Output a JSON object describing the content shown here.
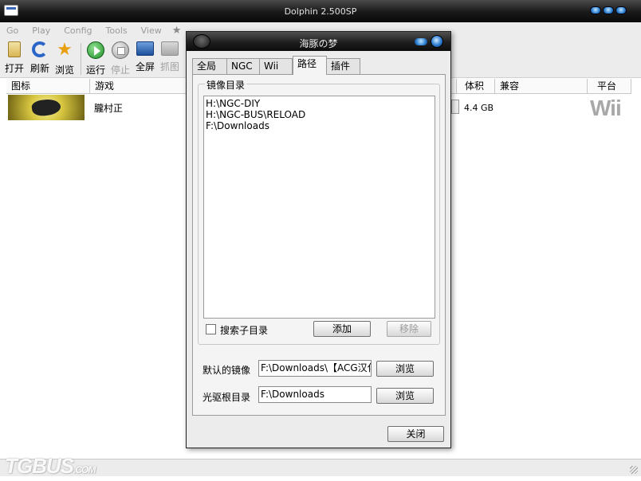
{
  "main_window": {
    "title": "Dolphin 2.500SP",
    "menu": [
      "Go",
      "Play",
      "Config",
      "Tools",
      "View"
    ],
    "toolbar": [
      {
        "label": "打开",
        "icon": "open-file-icon",
        "enabled": true
      },
      {
        "label": "刷新",
        "icon": "refresh-icon",
        "enabled": true
      },
      {
        "label": "浏览",
        "icon": "browse-star-icon",
        "enabled": true
      },
      {
        "label": "运行",
        "icon": "play-icon",
        "enabled": true
      },
      {
        "label": "停止",
        "icon": "stop-icon",
        "enabled": false
      },
      {
        "label": "全屏",
        "icon": "fullscreen-icon",
        "enabled": true
      },
      {
        "label": "抓图",
        "icon": "screenshot-icon",
        "enabled": false
      }
    ],
    "columns": {
      "icon": "图标",
      "game": "游戏",
      "size": "体积",
      "compat": "兼容",
      "platform": "平台"
    },
    "games": [
      {
        "title": "朧村正",
        "size": "4.4 GB",
        "platform": "Wii"
      }
    ]
  },
  "dialog": {
    "title": "海豚の梦",
    "tabs": [
      "全局",
      "NGC",
      "Wii",
      "路径",
      "插件"
    ],
    "active_tab": "路径",
    "iso_dirs": {
      "group_label": "镜像目录",
      "paths": [
        "H:\\NGC-DIY",
        "H:\\NGC-BUS\\RELOAD",
        "F:\\Downloads"
      ],
      "search_subfolders_label": "搜索子目录",
      "search_subfolders_checked": false,
      "add_label": "添加",
      "remove_label": "移除"
    },
    "default_iso": {
      "label": "默认的镜像",
      "value": "F:\\Downloads\\【ACG汉化",
      "browse_label": "浏览"
    },
    "dvd_root": {
      "label": "光驱根目录",
      "value": "F:\\Downloads",
      "browse_label": "浏览"
    },
    "close_label": "关闭"
  },
  "watermark": {
    "main": "TGBUS",
    "suffix": ".COM"
  },
  "colors": {
    "accent": "#2d7fd0",
    "titlebar": "#1a1a1a"
  }
}
